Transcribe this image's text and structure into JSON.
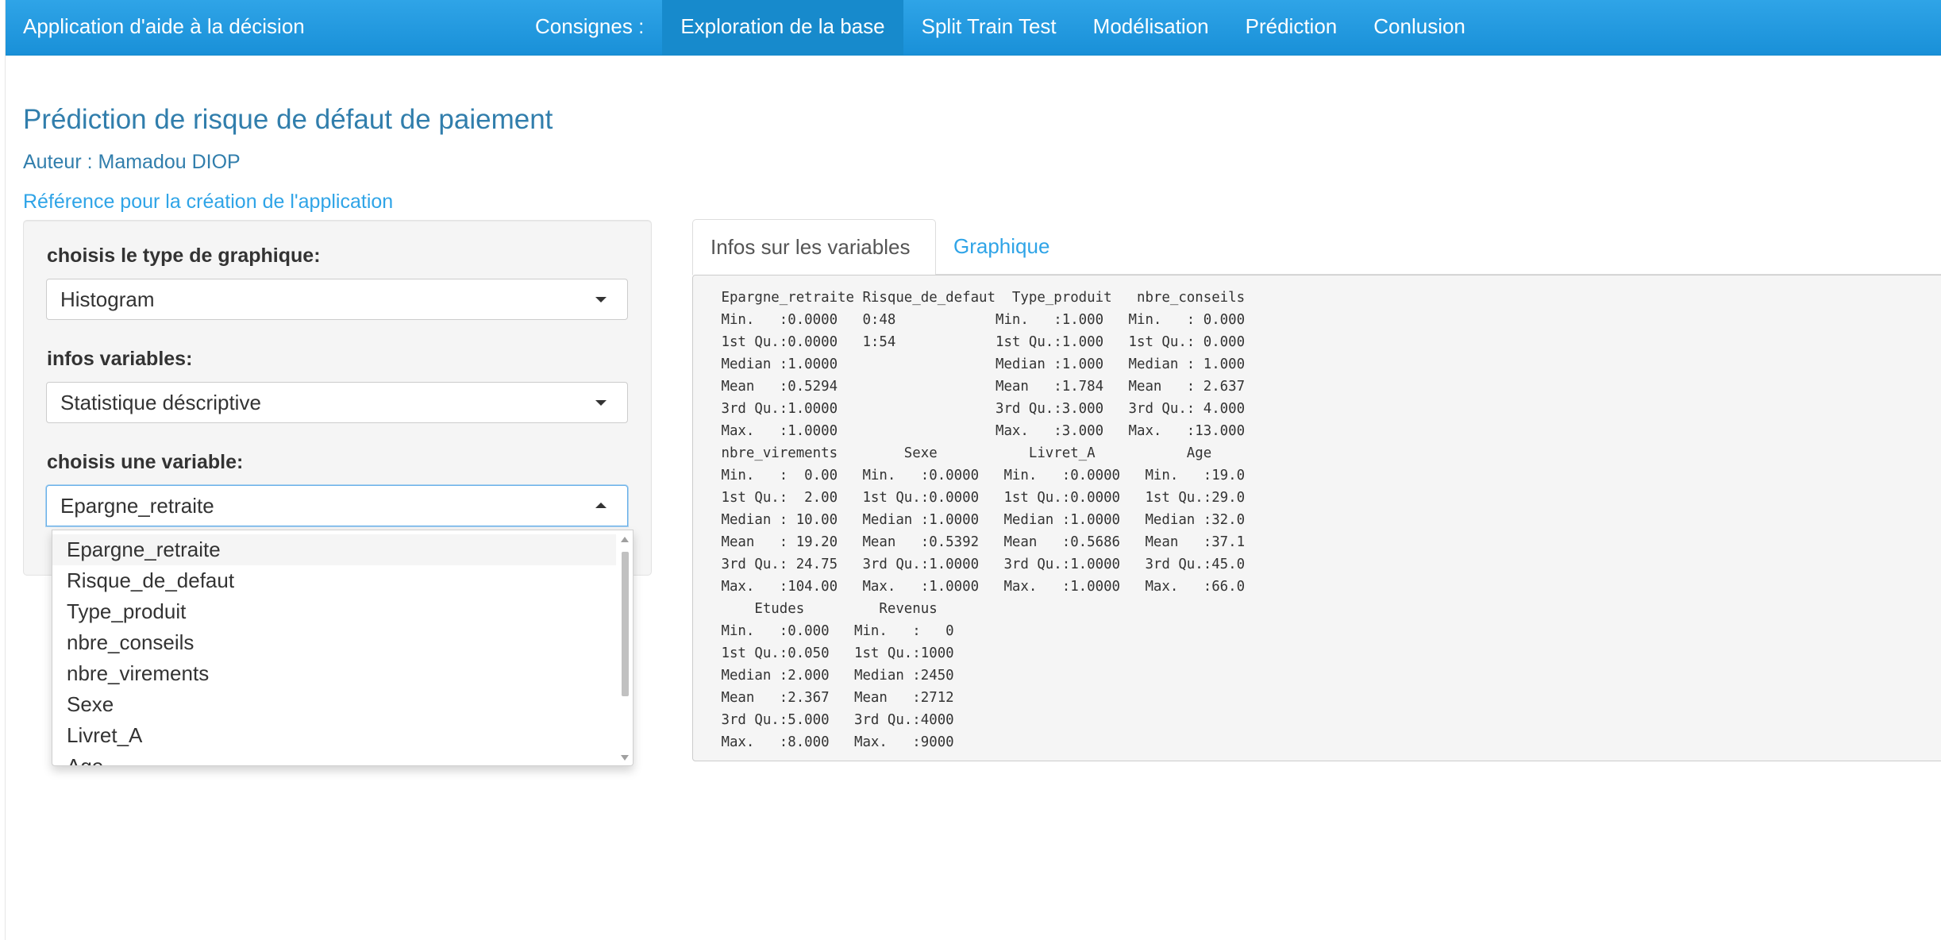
{
  "navbar": {
    "brand": "Application d'aide à la décision",
    "items": [
      {
        "label": "Consignes :"
      },
      {
        "label": "Exploration de la base"
      },
      {
        "label": "Split Train Test"
      },
      {
        "label": "Modélisation"
      },
      {
        "label": "Prédiction"
      },
      {
        "label": "Conlusion"
      }
    ],
    "active": "Exploration de la base"
  },
  "header": {
    "title": "Prédiction de risque de défaut de paiement",
    "author": "Auteur : Mamadou DIOP",
    "reference_link": "Référence pour la création de l'application"
  },
  "sidebar": {
    "chart_type": {
      "label": "choisis le type de graphique:",
      "value": "Histogram"
    },
    "info_vars": {
      "label": "infos variables:",
      "value": "Statistique déscriptive"
    },
    "variable": {
      "label": "choisis une variable:",
      "value": "Epargne_retraite",
      "options": [
        "Epargne_retraite",
        "Risque_de_defaut",
        "Type_produit",
        "nbre_conseils",
        "nbre_virements",
        "Sexe",
        "Livret_A",
        "Age"
      ]
    }
  },
  "main": {
    "tabs": [
      {
        "label": "Infos sur les variables"
      },
      {
        "label": "Graphique"
      }
    ],
    "summary_output": " Epargne_retraite Risque_de_defaut  Type_produit   nbre_conseils\n Min.   :0.0000   0:48            Min.   :1.000   Min.   : 0.000\n 1st Qu.:0.0000   1:54            1st Qu.:1.000   1st Qu.: 0.000\n Median :1.0000                   Median :1.000   Median : 1.000\n Mean   :0.5294                   Mean   :1.784   Mean   : 2.637\n 3rd Qu.:1.0000                   3rd Qu.:3.000   3rd Qu.: 4.000\n Max.   :1.0000                   Max.   :3.000   Max.   :13.000\n nbre_virements        Sexe           Livret_A           Age\n Min.   :  0.00   Min.   :0.0000   Min.   :0.0000   Min.   :19.0\n 1st Qu.:  2.00   1st Qu.:0.0000   1st Qu.:0.0000   1st Qu.:29.0\n Median : 10.00   Median :1.0000   Median :1.0000   Median :32.0\n Mean   : 19.20   Mean   :0.5392   Mean   :0.5686   Mean   :37.1\n 3rd Qu.: 24.75   3rd Qu.:1.0000   3rd Qu.:1.0000   3rd Qu.:45.0\n Max.   :104.00   Max.   :1.0000   Max.   :1.0000   Max.   :66.0\n     Etudes         Revenus\n Min.   :0.000   Min.   :   0\n 1st Qu.:0.050   1st Qu.:1000\n Median :2.000   Median :2450\n Mean   :2.367   Mean   :2712\n 3rd Qu.:5.000   3rd Qu.:4000\n Max.   :8.000   Max.   :9000"
  },
  "colors": {
    "primary": "#2fa4e7",
    "primary_dark": "#178acc",
    "heading": "#317eac"
  }
}
